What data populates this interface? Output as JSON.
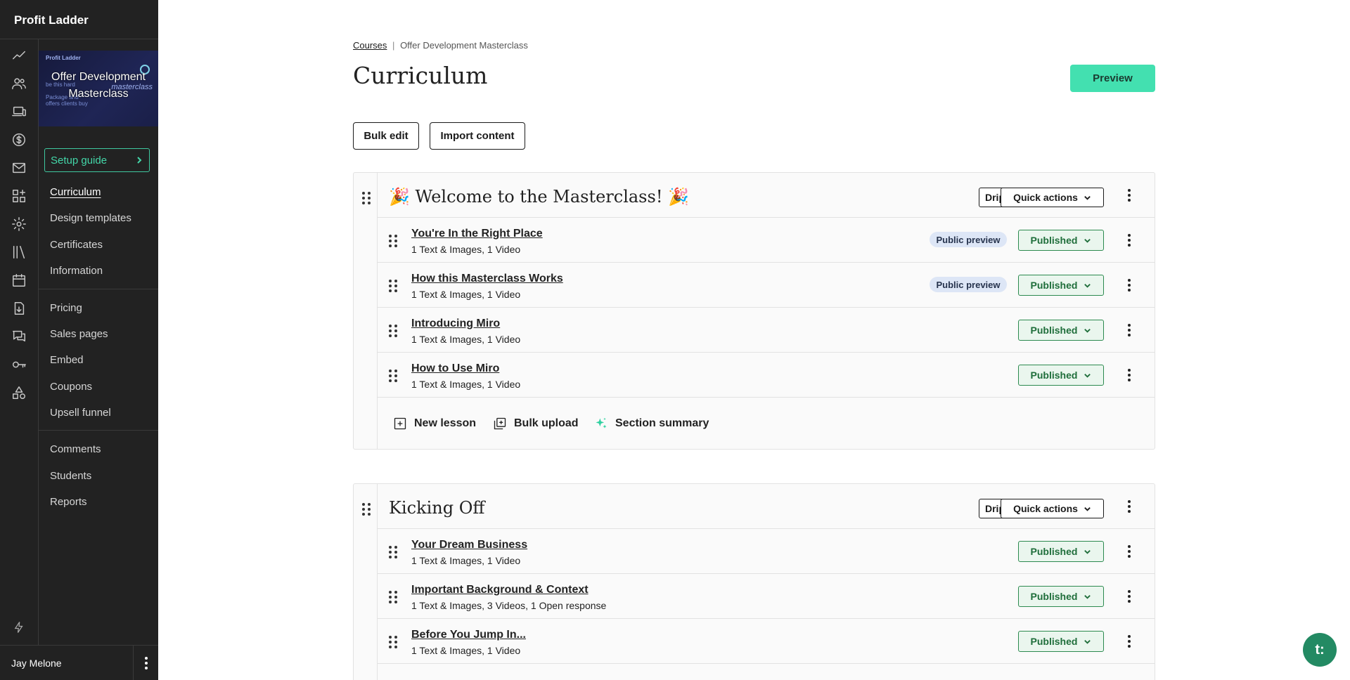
{
  "app": {
    "brand": "Profit Ladder"
  },
  "sidebar": {
    "rail_icons": [
      "analytics-icon",
      "people-icon",
      "devices-icon",
      "dollar-icon",
      "mail-icon",
      "apps-icon",
      "gear-icon",
      "library-icon",
      "calendar-icon",
      "download-icon",
      "chat-icon",
      "key-icon",
      "shapes-icon"
    ],
    "course_thumb": {
      "title": "Offer Development Masterclass",
      "brand_small": "Profit Ladder",
      "script_text": "masterclass",
      "line_1": "be this hard",
      "line_2": "Package and",
      "line_3": "offers clients buy"
    },
    "setup_guide": "Setup guide",
    "group1": [
      "Curriculum",
      "Design templates",
      "Certificates",
      "Information"
    ],
    "group2": [
      "Pricing",
      "Sales pages",
      "Embed",
      "Coupons",
      "Upsell funnel"
    ],
    "group3": [
      "Comments",
      "Students",
      "Reports"
    ],
    "user": "Jay Melone"
  },
  "breadcrumb": {
    "root": "Courses",
    "sep": "|",
    "current": "Offer Development Masterclass"
  },
  "page": {
    "title": "Curriculum",
    "preview": "Preview",
    "bulk_edit": "Bulk edit",
    "import_content": "Import content"
  },
  "section_controls": {
    "drip": "Drip",
    "quick_actions": "Quick actions"
  },
  "sections": [
    {
      "title": "🎉 Welcome to the Masterclass! 🎉",
      "lessons": [
        {
          "title": "You're In the Right Place",
          "meta": "1 Text & Images, 1 Video",
          "badge": "Public preview",
          "status": "Published"
        },
        {
          "title": "How this Masterclass Works",
          "meta": "1 Text & Images, 1 Video",
          "badge": "Public preview",
          "status": "Published"
        },
        {
          "title": "Introducing Miro",
          "meta": "1 Text & Images, 1 Video",
          "badge": "",
          "status": "Published"
        },
        {
          "title": "How to Use Miro",
          "meta": "1 Text & Images, 1 Video",
          "badge": "",
          "status": "Published"
        }
      ],
      "actions": {
        "new_lesson": "New lesson",
        "bulk_upload": "Bulk upload",
        "section_summary": "Section summary"
      }
    },
    {
      "title": "Kicking Off",
      "lessons": [
        {
          "title": "Your Dream Business",
          "meta": "1 Text & Images, 1 Video",
          "badge": "",
          "status": "Published"
        },
        {
          "title": "Important Background & Context",
          "meta": "1 Text & Images, 3 Videos, 1 Open response",
          "badge": "",
          "status": "Published"
        },
        {
          "title": "Before You Jump In...",
          "meta": "1 Text & Images, 1 Video",
          "badge": "",
          "status": "Published"
        }
      ]
    }
  ],
  "chat": {
    "label": "t:"
  },
  "colors": {
    "accent": "#43e0b0",
    "published_border": "#2c8a4f",
    "published_bg": "#eaf6ee",
    "badge_bg": "#dde6f6",
    "sidebar_bg": "#222222"
  }
}
